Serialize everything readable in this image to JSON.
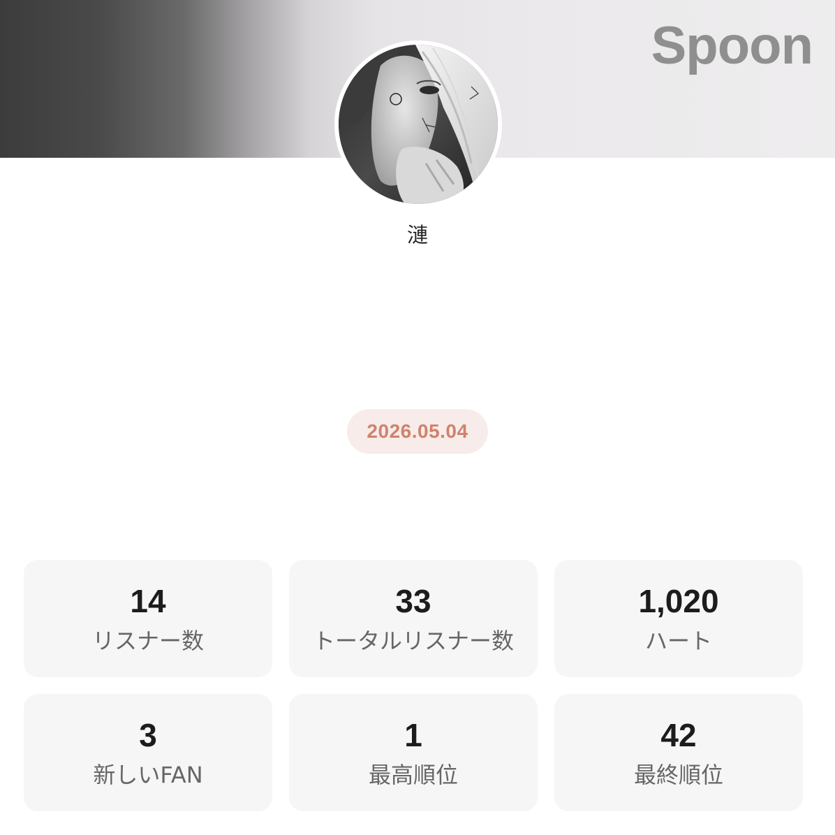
{
  "header": {
    "brand": "Spoon",
    "colors": {
      "brand_text": "#8f8f8f",
      "banner_dark": "#3c3c3c",
      "banner_light": "#eeedee"
    }
  },
  "profile": {
    "name": "漣",
    "avatar_icon": "profile-photo"
  },
  "broadcast": {
    "date": "2026.05.04",
    "colors": {
      "pill_bg": "#f7ece9",
      "pill_text": "#d0826c"
    }
  },
  "stats": [
    {
      "value": "14",
      "label": "リスナー数"
    },
    {
      "value": "33",
      "label": "トータルリスナー数"
    },
    {
      "value": "1,020",
      "label": "ハート"
    },
    {
      "value": "3",
      "label": "新しいFAN"
    },
    {
      "value": "1",
      "label": "最高順位"
    },
    {
      "value": "42",
      "label": "最終順位"
    }
  ]
}
